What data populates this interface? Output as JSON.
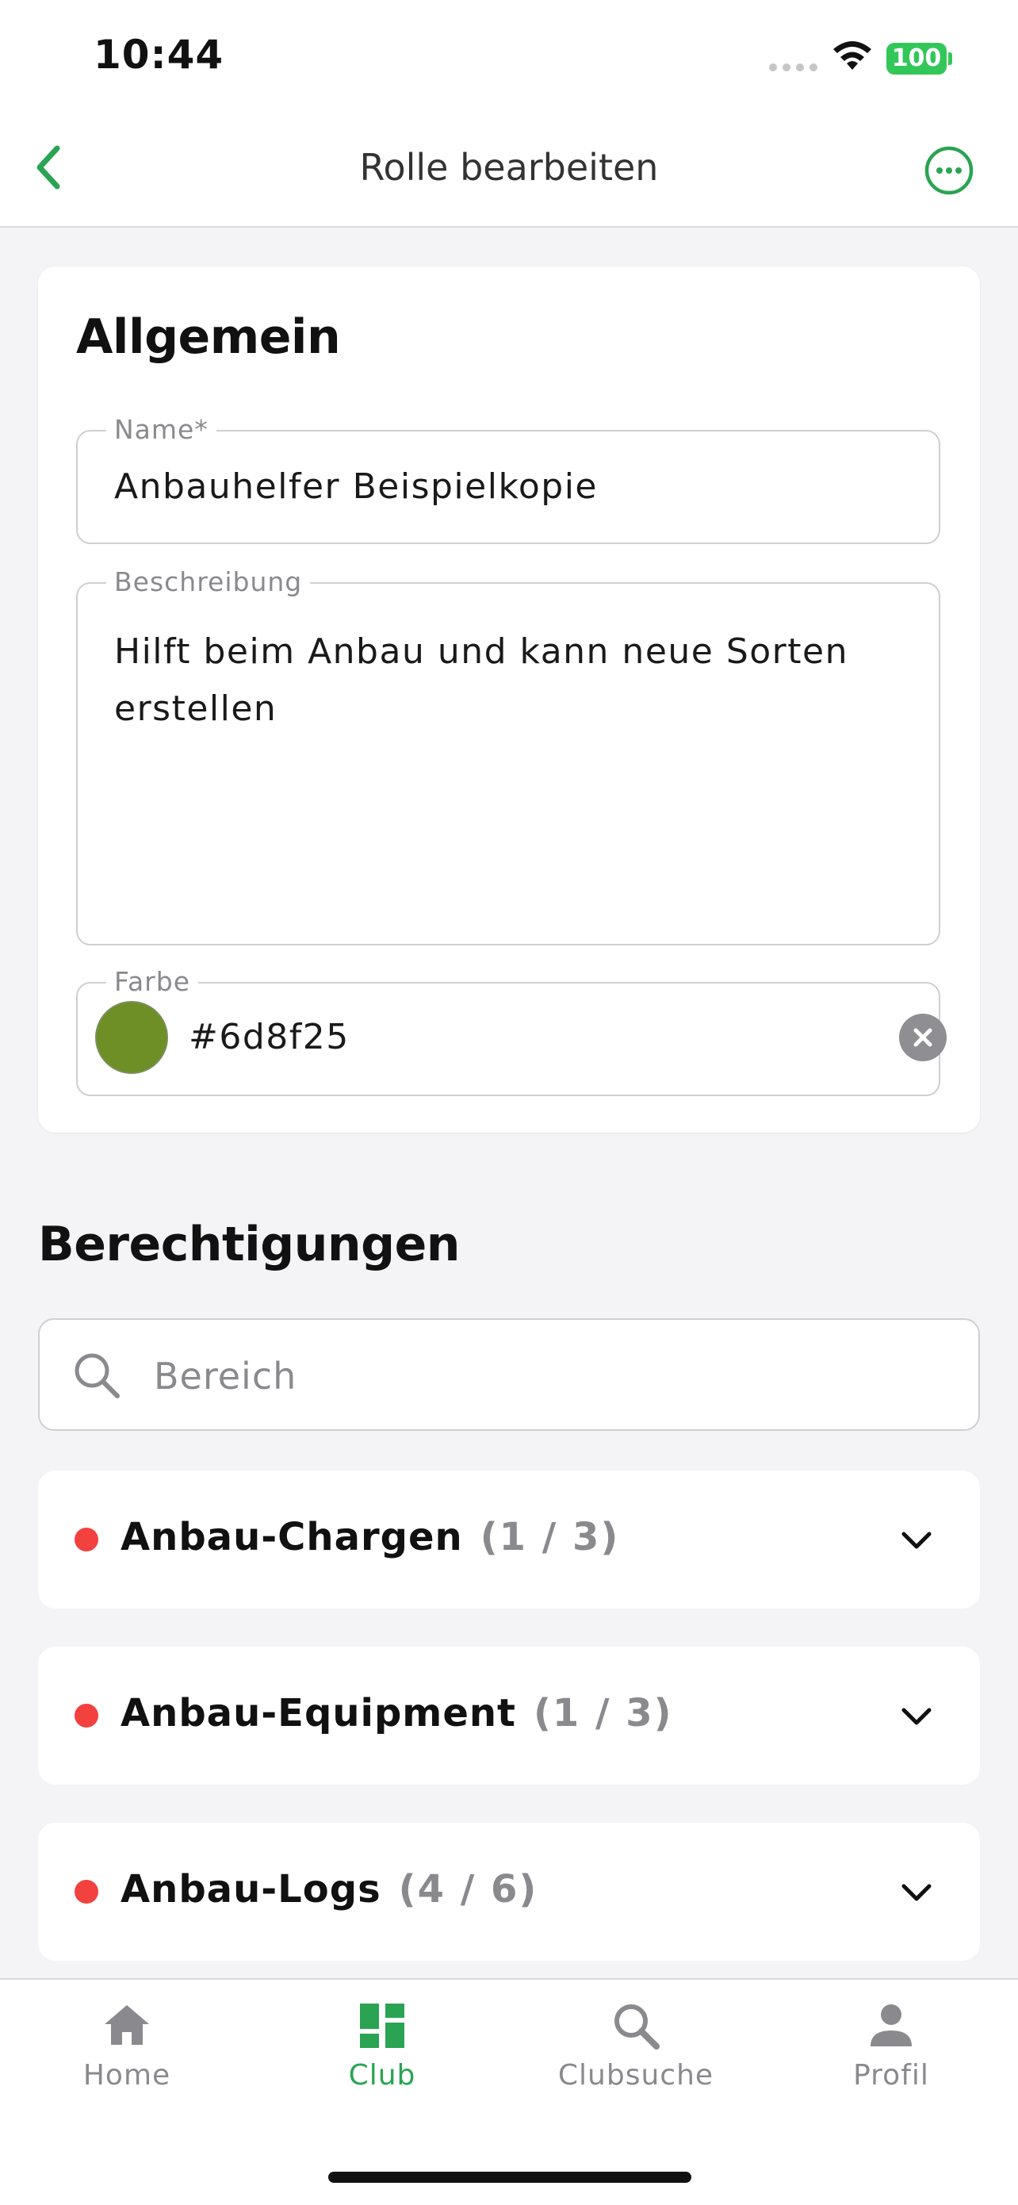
{
  "status_bar": {
    "time": "10:44",
    "battery": "100"
  },
  "header": {
    "title": "Rolle bearbeiten",
    "back_icon": "chevron-left-icon",
    "more_icon": "ellipsis-circle-icon"
  },
  "general": {
    "heading": "Allgemein",
    "name": {
      "label": "Name*",
      "value": "Anbauhelfer Beispielkopie"
    },
    "description": {
      "label": "Beschreibung",
      "value": "Hilft beim Anbau und kann neue Sorten erstellen"
    },
    "color": {
      "label": "Farbe",
      "value": "#6d8f25",
      "swatch": "#6d8f25"
    }
  },
  "permissions": {
    "heading": "Berechtigungen",
    "search": {
      "placeholder": "Bereich",
      "value": ""
    },
    "items": [
      {
        "label": "Anbau-Chargen",
        "count": "(1 / 3)",
        "status_color": "#f2413f"
      },
      {
        "label": "Anbau-Equipment",
        "count": "(1 / 3)",
        "status_color": "#f2413f"
      },
      {
        "label": "Anbau-Logs",
        "count": "(4 / 6)",
        "status_color": "#f2413f"
      }
    ]
  },
  "tabs": [
    {
      "label": "Home",
      "icon": "home-icon",
      "active": false
    },
    {
      "label": "Club",
      "icon": "dashboard-icon",
      "active": true
    },
    {
      "label": "Clubsuche",
      "icon": "search-icon",
      "active": false
    },
    {
      "label": "Profil",
      "icon": "person-icon",
      "active": false
    }
  ],
  "colors": {
    "accent": "#2aa452",
    "background": "#f4f4f6",
    "muted": "#8a8a8e"
  }
}
